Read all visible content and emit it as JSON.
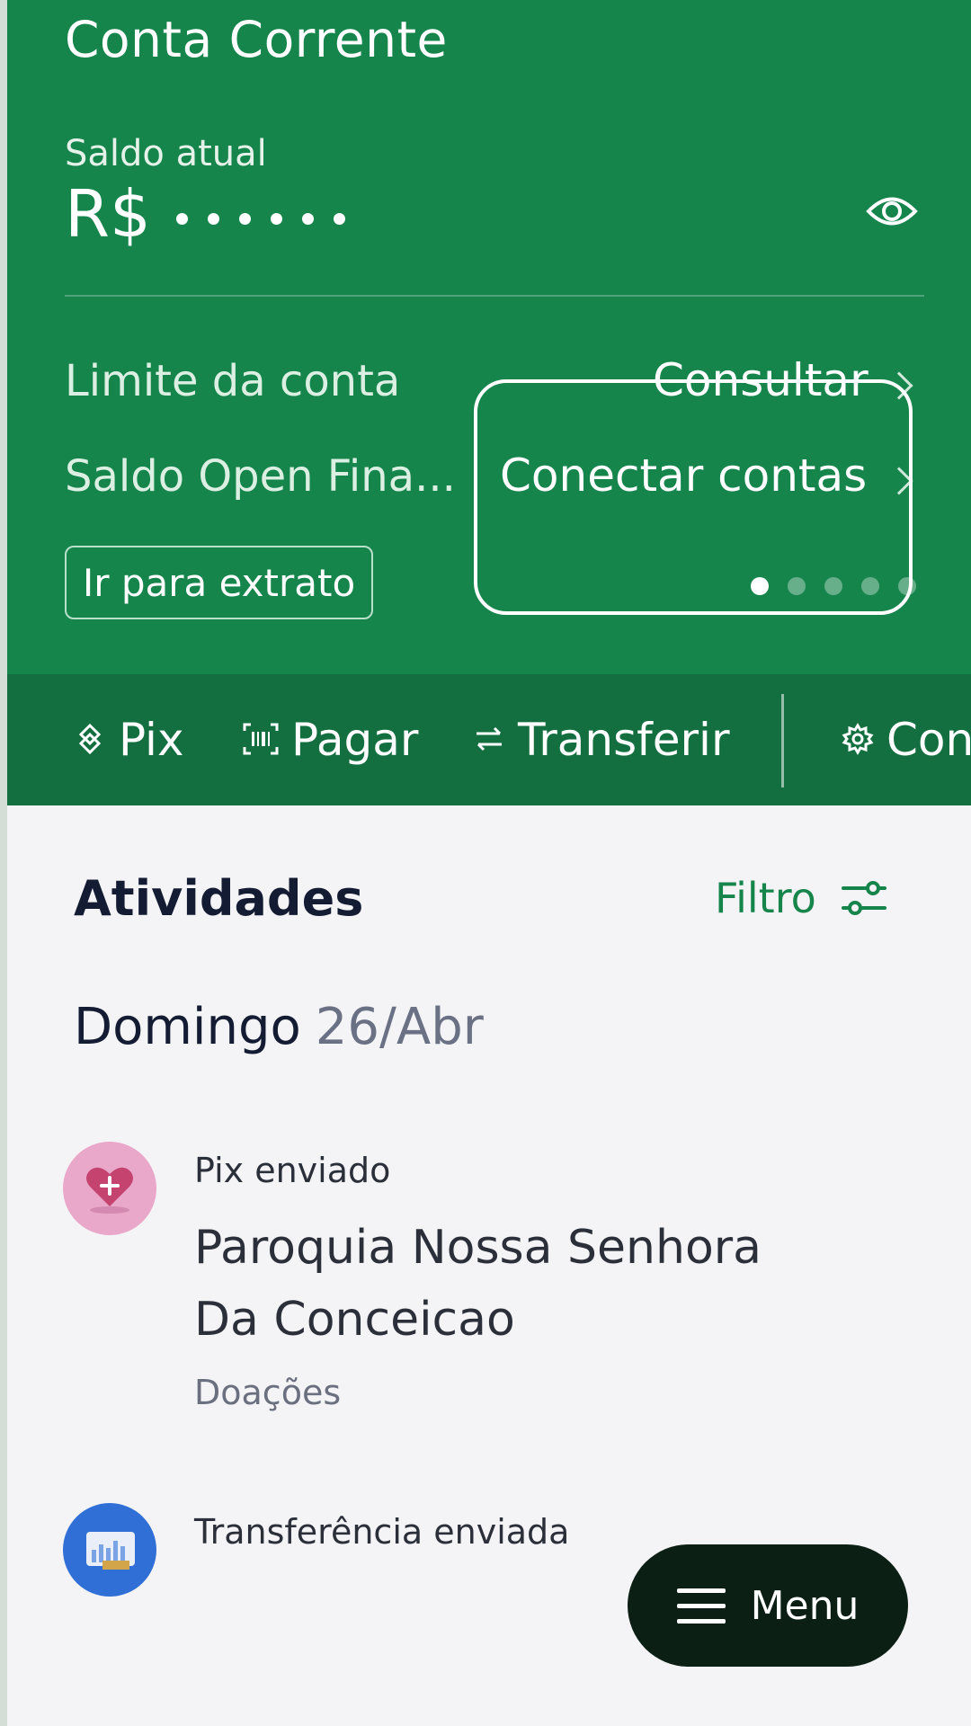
{
  "account": {
    "title": "Conta Corrente",
    "balance_label": "Saldo atual",
    "currency": "R$",
    "balance_hidden_dots": 6
  },
  "rows": [
    {
      "label": "Limite da conta",
      "value": "Consultar"
    },
    {
      "label": "Saldo Open Fina...",
      "value": "Conectar contas"
    }
  ],
  "extrato_button": "Ir para extrato",
  "carousel": {
    "pages": 5,
    "active": 0
  },
  "actions": [
    {
      "label": "Pix",
      "icon": "pix-icon"
    },
    {
      "label": "Pagar",
      "icon": "barcode-icon"
    },
    {
      "label": "Transferir",
      "icon": "transfer-icon"
    },
    {
      "label": "Con",
      "icon": "gear-icon"
    }
  ],
  "activities": {
    "title": "Atividades",
    "filter_label": "Filtro",
    "day": {
      "weekday": "Domingo",
      "date": "26/Abr"
    },
    "transactions": [
      {
        "type": "Pix enviado",
        "name": "Paroquia Nossa Senhora Da Conceicao",
        "category": "Doações",
        "avatar": "heart-plus-icon"
      },
      {
        "type": "Transferência enviada",
        "name": "",
        "category": "",
        "avatar": "monitor-chart-icon"
      }
    ]
  },
  "menu_button": "Menu",
  "colors": {
    "header_green": "#16854c",
    "action_bar_green": "#136f40",
    "menu_dark": "#0c1f14"
  }
}
